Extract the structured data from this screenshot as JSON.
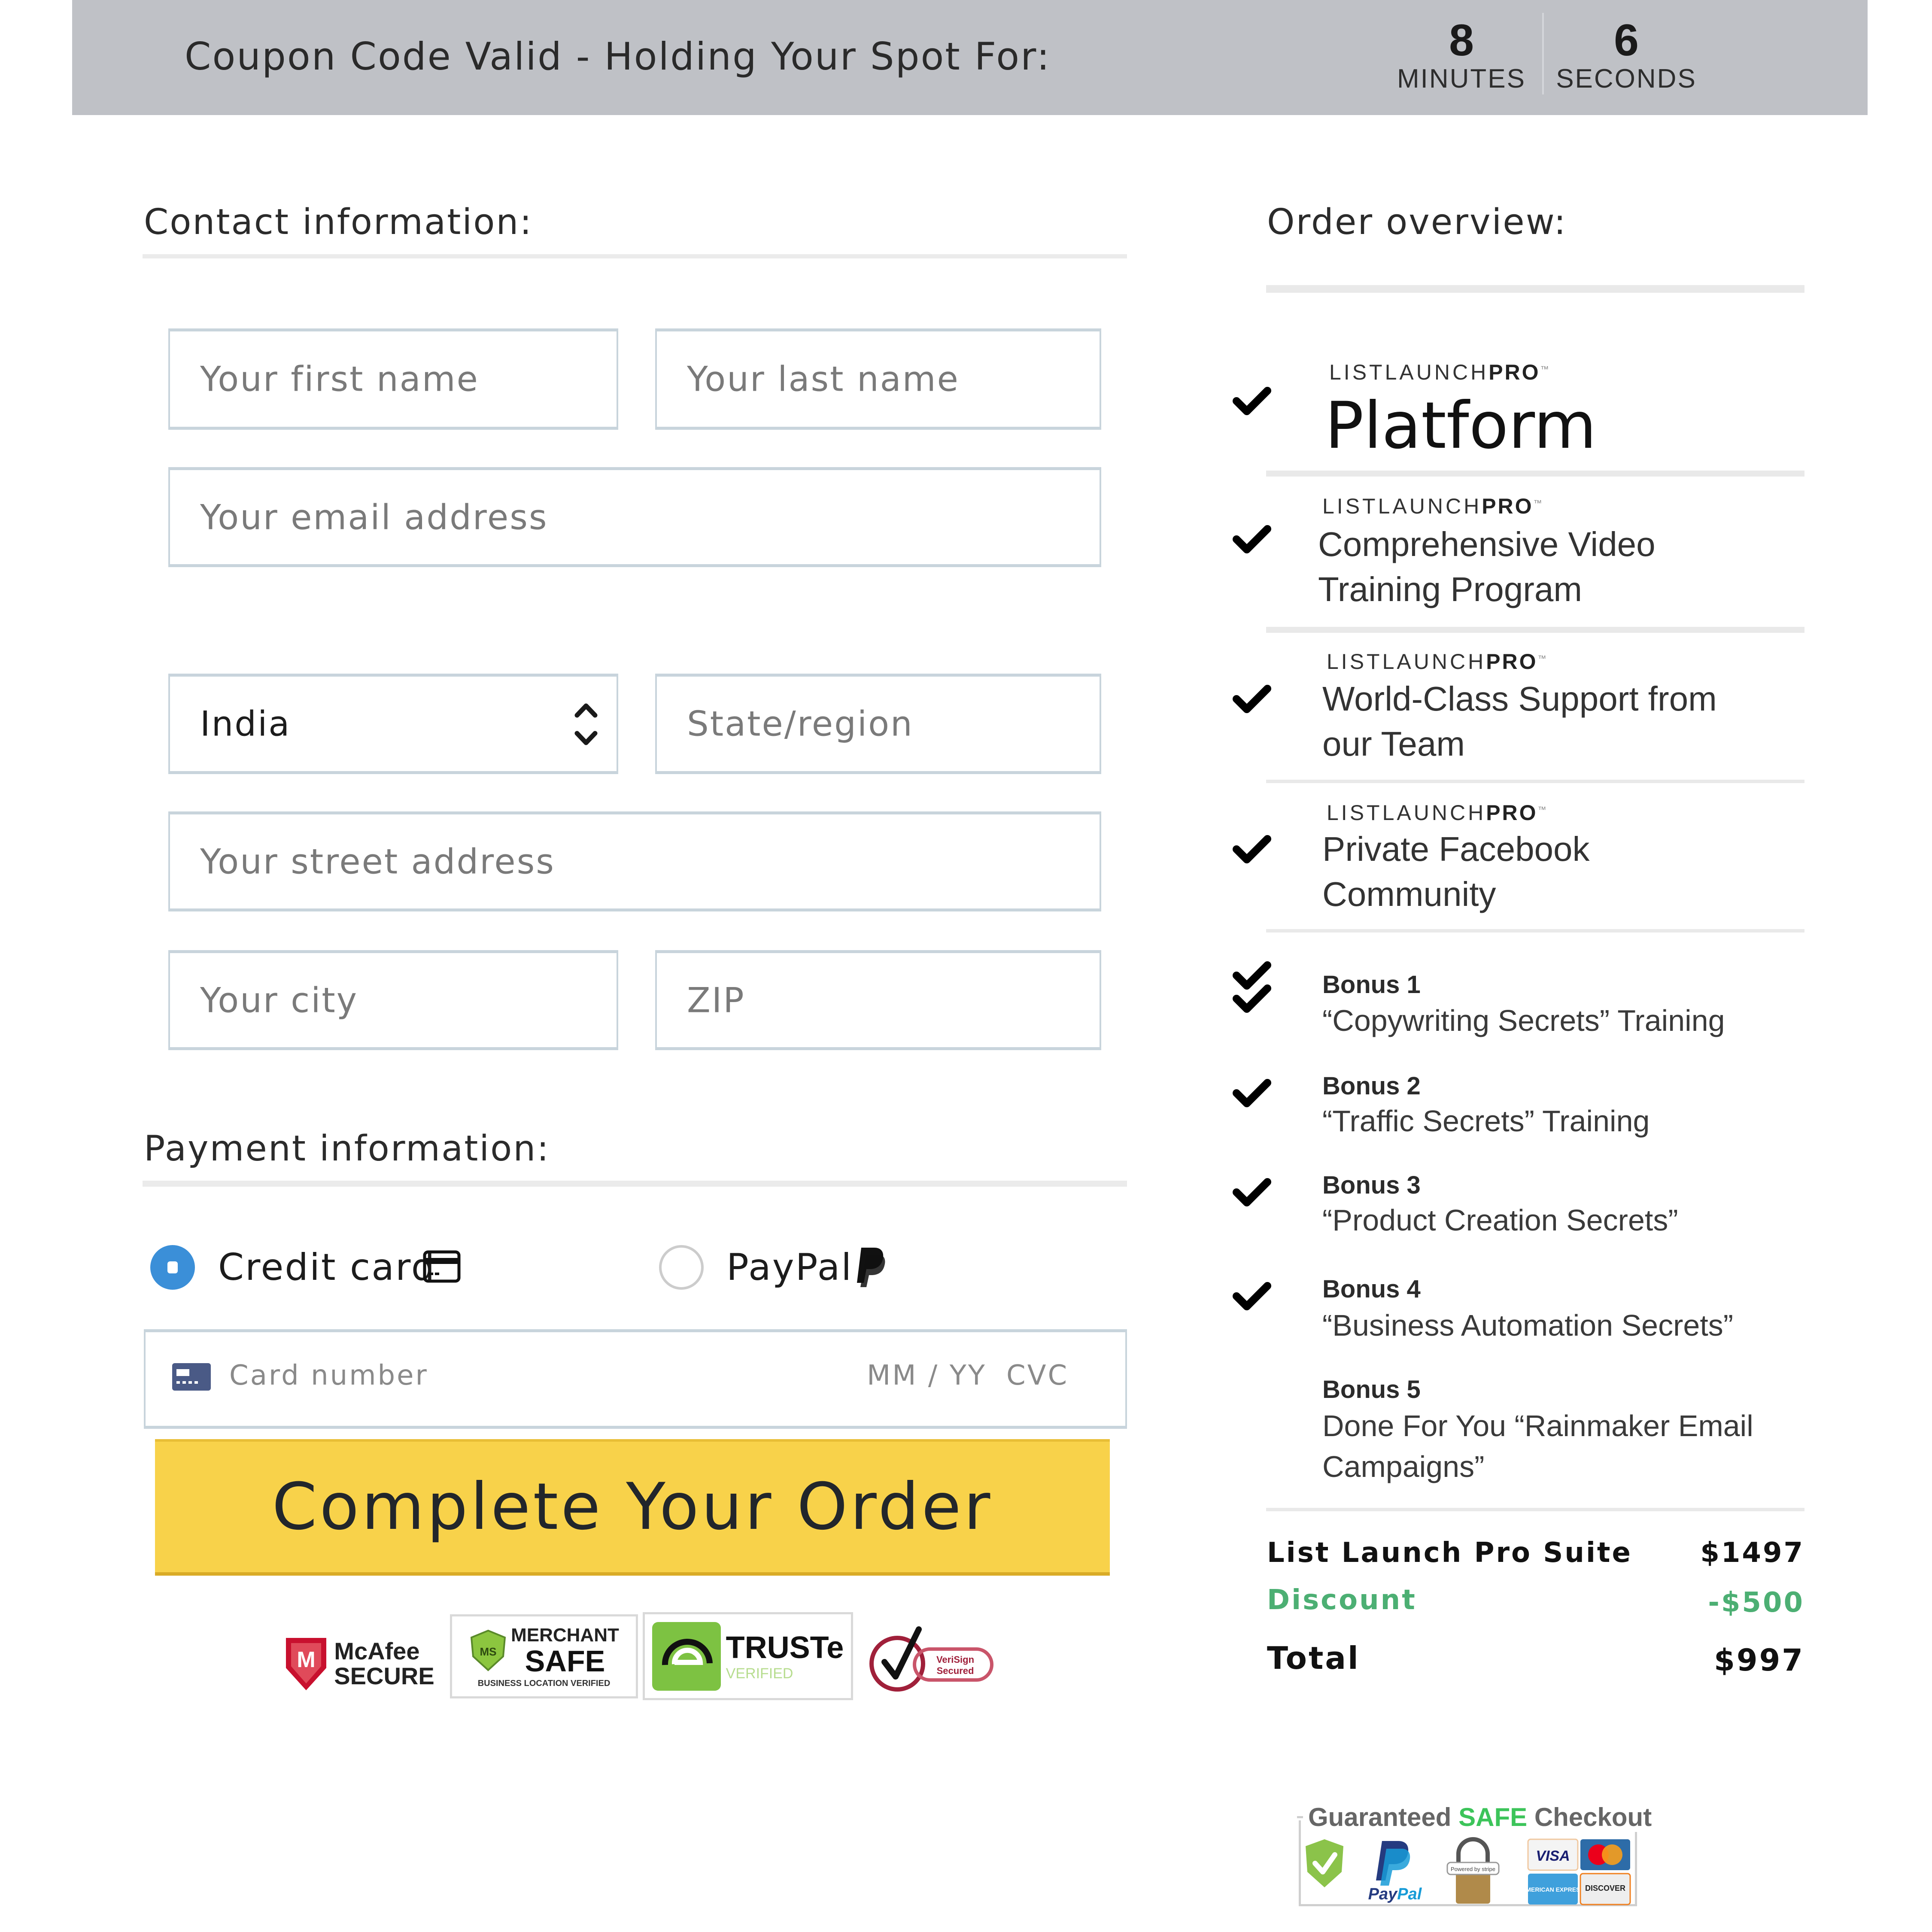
{
  "header": {
    "message": "Coupon Code Valid - Holding Your Spot For:",
    "timer": {
      "minutes": "8",
      "minutes_label": "MINUTES",
      "seconds": "6",
      "seconds_label": "SECONDS"
    }
  },
  "contact": {
    "heading": "Contact information:",
    "first_name": {
      "placeholder": "Your first name",
      "value": ""
    },
    "last_name": {
      "placeholder": "Your last name",
      "value": ""
    },
    "email": {
      "placeholder": "Your email address",
      "value": ""
    },
    "country": {
      "selected": "India"
    },
    "state": {
      "placeholder": "State/region",
      "value": ""
    },
    "street": {
      "placeholder": "Your street address",
      "value": ""
    },
    "city": {
      "placeholder": "Your city",
      "value": ""
    },
    "zip": {
      "placeholder": "ZIP",
      "value": ""
    }
  },
  "payment": {
    "heading": "Payment information:",
    "methods": [
      {
        "label": "Credit card",
        "icon": "credit-card-icon",
        "selected": true
      },
      {
        "label": "PayPal",
        "icon": "paypal-icon",
        "selected": false
      }
    ],
    "card": {
      "number_placeholder": "Card number",
      "expiry_placeholder": "MM / YY",
      "cvc_placeholder": "CVC"
    },
    "submit_label": "Complete Your Order",
    "trust_badges": [
      {
        "name": "McAfee",
        "line1": "McAfee",
        "line2": "SECURE"
      },
      {
        "name": "Merchant Safe",
        "line1": "MERCHANT",
        "line2": "SAFE",
        "line3": "BUSINESS LOCATION VERIFIED"
      },
      {
        "name": "TRUSTe",
        "line1": "TRUSTe",
        "line2": "VERIFIED"
      },
      {
        "name": "VeriSign",
        "line1": "VeriSign",
        "line2": "Secured"
      }
    ]
  },
  "order": {
    "heading": "Order overview:",
    "brand": {
      "light": "LISTLAUNCH",
      "bold": "PRO",
      "tm": "™"
    },
    "products": [
      {
        "lines": [
          "Platform"
        ]
      },
      {
        "lines": [
          "Comprehensive Video",
          "Training Program"
        ]
      },
      {
        "lines": [
          "World-Class Support from",
          "our Team"
        ]
      },
      {
        "lines": [
          "Private Facebook",
          "Community"
        ]
      }
    ],
    "bonuses": [
      {
        "title": "Bonus 1",
        "lines": [
          "“Copywriting Secrets” Training"
        ],
        "checked": true
      },
      {
        "title": "Bonus 2",
        "lines": [
          "“Traffic Secrets” Training"
        ],
        "checked": true
      },
      {
        "title": "Bonus 3",
        "lines": [
          "“Product Creation Secrets”"
        ],
        "checked": true
      },
      {
        "title": "Bonus 4",
        "lines": [
          "“Business Automation Secrets”"
        ],
        "checked": true
      },
      {
        "title": "Bonus 5",
        "lines": [
          "Done For You “Rainmaker Email",
          "Campaigns”"
        ],
        "checked": false
      }
    ],
    "summary": {
      "suite_label": "List Launch Pro Suite",
      "suite_price": "$1497",
      "discount_label": "Discount",
      "discount_value": "-$500",
      "total_label": "Total",
      "total_value": "$997"
    },
    "safe_checkout": {
      "title_pre": "Guaranteed",
      "title_highlight": "SAFE",
      "title_post": "Checkout",
      "logos": [
        "shield-check",
        "PayPal",
        "Powered by stripe",
        "VISA",
        "MasterCard",
        "American Express",
        "DISCOVER"
      ]
    }
  },
  "colors": {
    "header_bg": "#bfc1c6",
    "button_bg": "#f8d24a",
    "radio_selected": "#3b8fd8",
    "discount_green": "#4caf73",
    "field_border": "#c8d4dc"
  }
}
